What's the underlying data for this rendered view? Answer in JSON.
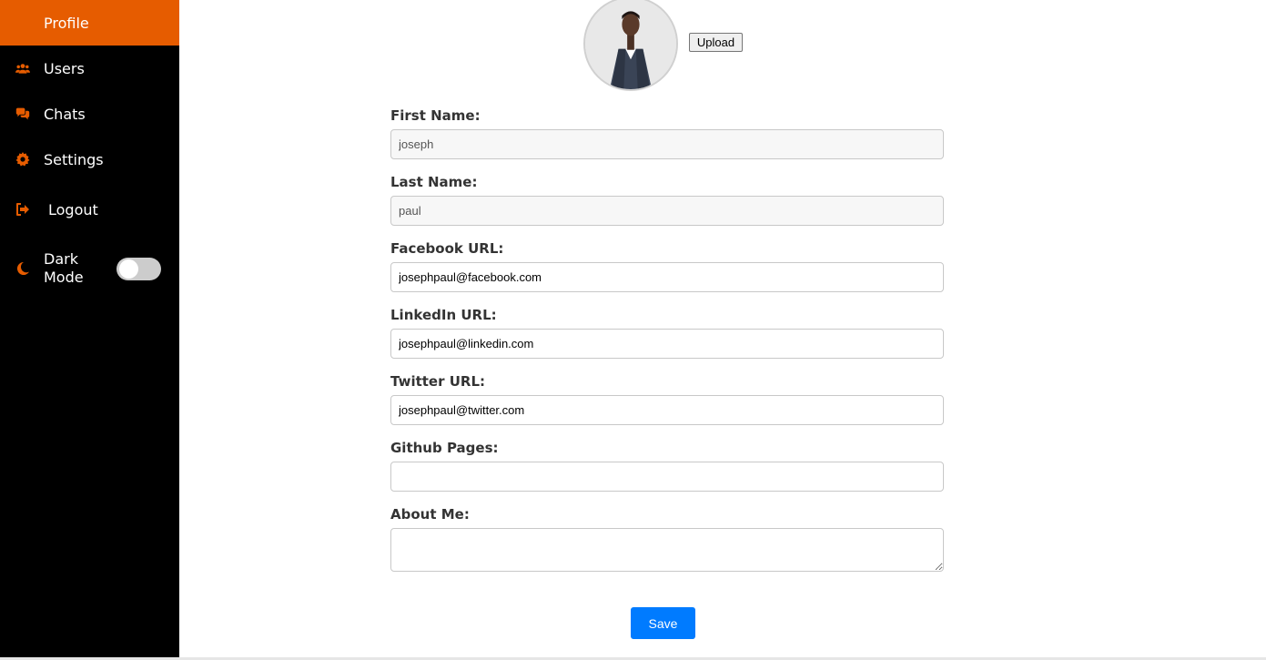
{
  "theme": {
    "accent": "#e65c00",
    "sidebar_bg": "#000000",
    "primary": "#007bff"
  },
  "sidebar": {
    "items": [
      {
        "label": "Profile",
        "icon": "profile",
        "active": true
      },
      {
        "label": "Users",
        "icon": "users-icon"
      },
      {
        "label": "Chats",
        "icon": "chats-icon"
      },
      {
        "label": "Settings",
        "icon": "gear-icon"
      },
      {
        "label": "Logout",
        "icon": "logout-icon"
      }
    ],
    "dark_mode": {
      "label": "Dark Mode",
      "icon": "moon-icon",
      "enabled": false
    }
  },
  "profile": {
    "avatar": "profile-photo",
    "upload_label": "Upload"
  },
  "form": {
    "first_name": {
      "label": "First Name:",
      "value": "joseph"
    },
    "last_name": {
      "label": "Last Name:",
      "value": "paul"
    },
    "facebook": {
      "label": "Facebook URL:",
      "value": "josephpaul@facebook.com"
    },
    "linkedin": {
      "label": "LinkedIn URL:",
      "value": "josephpaul@linkedin.com"
    },
    "twitter": {
      "label": "Twitter URL:",
      "value": "josephpaul@twitter.com"
    },
    "github": {
      "label": "Github Pages:",
      "value": ""
    },
    "about": {
      "label": "About Me:",
      "value": ""
    },
    "save_label": "Save"
  }
}
